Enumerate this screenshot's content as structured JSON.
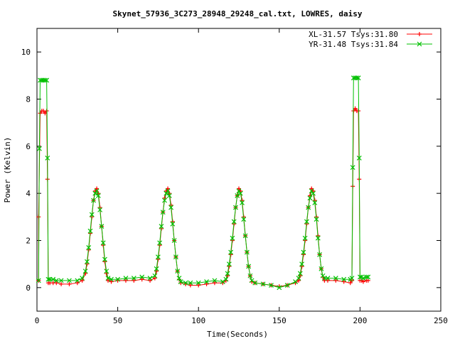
{
  "chart_data": {
    "type": "line",
    "title": "Skynet_57936_3C273_28948_29248_cal.txt, LOWRES, daisy",
    "xlabel": "Time(Seconds)",
    "ylabel": "Power (Kelvin)",
    "xlim": [
      0,
      250
    ],
    "ylim": [
      -1,
      11
    ],
    "xticks": [
      0,
      50,
      100,
      150,
      200,
      250
    ],
    "yticks": [
      0,
      2,
      4,
      6,
      8,
      10
    ],
    "grid": false,
    "legend_position": "top-right",
    "series": [
      {
        "name": "XL-31.57 Tsys:31.80",
        "color": "#ff0000",
        "marker": "+",
        "x": [
          1,
          1,
          2,
          3,
          4,
          5,
          6,
          6.5,
          7,
          8,
          10,
          12,
          15,
          20,
          25,
          28,
          30,
          31,
          32,
          33,
          34,
          35,
          36,
          37,
          38,
          39,
          40,
          41,
          42,
          43,
          44,
          46,
          50,
          55,
          60,
          65,
          70,
          73,
          74,
          75,
          76,
          77,
          78,
          79,
          80,
          81,
          82,
          83,
          84,
          85,
          86,
          87,
          88,
          89,
          92,
          95,
          100,
          105,
          110,
          115,
          117,
          118,
          119,
          120,
          121,
          122,
          123,
          124,
          125,
          126,
          127,
          128,
          129,
          130,
          131,
          132,
          133,
          135,
          140,
          145,
          150,
          155,
          160,
          162,
          163,
          164,
          165,
          166,
          167,
          168,
          169,
          170,
          171,
          172,
          173,
          174,
          175,
          176,
          177,
          178,
          180,
          185,
          190,
          194,
          195,
          195.5,
          196,
          197,
          198,
          199,
          199.5,
          200,
          201,
          202,
          204,
          205
        ],
        "y": [
          0.3,
          3.0,
          7.4,
          7.5,
          7.5,
          7.4,
          7.5,
          4.6,
          0.2,
          0.2,
          0.2,
          0.2,
          0.15,
          0.15,
          0.2,
          0.3,
          0.6,
          1.0,
          1.6,
          2.3,
          3.0,
          3.7,
          4.1,
          4.2,
          4.0,
          3.4,
          2.6,
          1.8,
          1.1,
          0.6,
          0.3,
          0.25,
          0.3,
          0.3,
          0.3,
          0.35,
          0.3,
          0.4,
          0.7,
          1.2,
          1.8,
          2.5,
          3.2,
          3.8,
          4.1,
          4.2,
          4.0,
          3.5,
          2.8,
          2.0,
          1.3,
          0.7,
          0.35,
          0.2,
          0.15,
          0.1,
          0.1,
          0.15,
          0.2,
          0.2,
          0.3,
          0.5,
          0.9,
          1.4,
          2.0,
          2.7,
          3.4,
          3.9,
          4.2,
          4.1,
          3.7,
          3.0,
          2.2,
          1.5,
          0.9,
          0.5,
          0.25,
          0.2,
          0.15,
          0.1,
          0.05,
          0.1,
          0.2,
          0.3,
          0.5,
          0.9,
          1.4,
          2.0,
          2.7,
          3.4,
          3.9,
          4.2,
          4.1,
          3.7,
          3.0,
          2.2,
          1.4,
          0.8,
          0.45,
          0.3,
          0.3,
          0.3,
          0.25,
          0.2,
          0.3,
          4.3,
          7.5,
          7.6,
          7.5,
          7.5,
          4.6,
          0.3,
          0.3,
          0.25,
          0.3,
          0.3
        ]
      },
      {
        "name": "YR-31.48 Tsys:31.84",
        "color": "#00c000",
        "marker": "x",
        "x": [
          1,
          1.5,
          2,
          3,
          4,
          5,
          6,
          6.5,
          7,
          8,
          10,
          12,
          15,
          20,
          25,
          28,
          30,
          31,
          32,
          33,
          34,
          35,
          36,
          37,
          38,
          39,
          40,
          41,
          42,
          43,
          44,
          46,
          50,
          55,
          60,
          65,
          70,
          73,
          74,
          75,
          76,
          77,
          78,
          79,
          80,
          81,
          82,
          83,
          84,
          85,
          86,
          87,
          88,
          89,
          92,
          95,
          100,
          105,
          110,
          115,
          117,
          118,
          119,
          120,
          121,
          122,
          123,
          124,
          125,
          126,
          127,
          128,
          129,
          130,
          131,
          132,
          133,
          135,
          140,
          145,
          150,
          155,
          160,
          162,
          163,
          164,
          165,
          166,
          167,
          168,
          169,
          170,
          171,
          172,
          173,
          174,
          175,
          176,
          177,
          178,
          180,
          185,
          190,
          194,
          195,
          195.5,
          196,
          197,
          198,
          199,
          199.5,
          200,
          201,
          202,
          204,
          205
        ],
        "y": [
          0.3,
          5.9,
          8.8,
          8.8,
          8.8,
          8.8,
          8.8,
          5.5,
          0.35,
          0.35,
          0.35,
          0.3,
          0.3,
          0.3,
          0.3,
          0.4,
          0.7,
          1.1,
          1.7,
          2.4,
          3.1,
          3.7,
          4.0,
          4.1,
          3.9,
          3.3,
          2.6,
          1.9,
          1.2,
          0.7,
          0.4,
          0.35,
          0.35,
          0.4,
          0.4,
          0.45,
          0.4,
          0.5,
          0.8,
          1.3,
          1.9,
          2.6,
          3.2,
          3.7,
          4.0,
          4.1,
          3.9,
          3.4,
          2.7,
          2.0,
          1.3,
          0.7,
          0.4,
          0.25,
          0.2,
          0.2,
          0.2,
          0.25,
          0.3,
          0.25,
          0.35,
          0.6,
          1.0,
          1.5,
          2.1,
          2.8,
          3.4,
          3.9,
          4.1,
          4.0,
          3.6,
          2.9,
          2.2,
          1.5,
          0.9,
          0.5,
          0.3,
          0.2,
          0.15,
          0.1,
          0.0,
          0.1,
          0.25,
          0.4,
          0.6,
          1.0,
          1.5,
          2.1,
          2.8,
          3.4,
          3.8,
          4.1,
          4.0,
          3.6,
          2.9,
          2.1,
          1.4,
          0.8,
          0.5,
          0.4,
          0.4,
          0.4,
          0.35,
          0.35,
          0.4,
          5.1,
          8.9,
          8.9,
          8.9,
          8.9,
          5.5,
          0.45,
          0.45,
          0.4,
          0.45,
          0.45
        ]
      }
    ]
  }
}
